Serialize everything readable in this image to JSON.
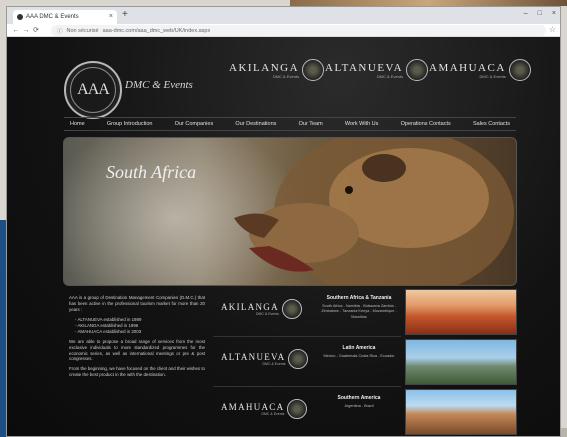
{
  "browser": {
    "tab_title": "AAA DMC & Events",
    "tab_close": "×",
    "new_tab": "+",
    "win_min": "–",
    "win_max": "□",
    "win_close": "×",
    "back": "←",
    "forward": "→",
    "reload": "⟳",
    "security": "Non sécurisé",
    "url": "aaa-dmc.com/aaa_dmc_web/UK/index.aspx"
  },
  "site": {
    "logo_text": "AAA",
    "logo_tagline": "DMC & Events",
    "brands": [
      {
        "name": "AKILANGA",
        "sub": "DMC & Events"
      },
      {
        "name": "ALTANUEVA",
        "sub": "DMC & Events"
      },
      {
        "name": "AMAHUACA",
        "sub": "DMC & Events"
      }
    ],
    "nav": [
      "Home",
      "Group Introduction",
      "Our Companies",
      "Our Destinations",
      "Our Team",
      "Work With Us",
      "Operations Contacts",
      "Sales Contacts"
    ],
    "hero_title": "South Africa",
    "about": {
      "p1": "AAA is a group of Destination Management Companies (D.M.C.) that has been active in the professional tourism market for more than 20 years :",
      "items": [
        "- ALTANUEVA established in 1989",
        "- AKILANGA established in 1996",
        "- AMAHUACA established in 2003"
      ],
      "p2": "We are able to propose a broad range of services from the most exclusive individuals to more standardized programmes for the economic series, as well as international meetings or pre & post congresses.",
      "p3": "From the beginning, we have focused on the client and their wishes to create the best product in the with the destination."
    },
    "regions": [
      {
        "brand": "AKILANGA",
        "sub": "DMC & Events",
        "heading": "Southern Africa & Tanzania",
        "countries": "South Africa - Namibia - Botswana Zambia - Zimbabwe - Tanzania Kenya - Mozambique - Mauritius"
      },
      {
        "brand": "ALTANUEVA",
        "sub": "DMC & Events",
        "heading": "Latin America",
        "countries": "Mexico - Guatemala Costa Rica - Ecuador"
      },
      {
        "brand": "AMAHUACA",
        "sub": "DMC & Events",
        "heading": "Southern America",
        "countries": "Argentina - Brazil"
      }
    ]
  },
  "colors": {
    "site_bg": "#121212",
    "text": "#e0e0e0",
    "accent": "#b8b8b8"
  }
}
